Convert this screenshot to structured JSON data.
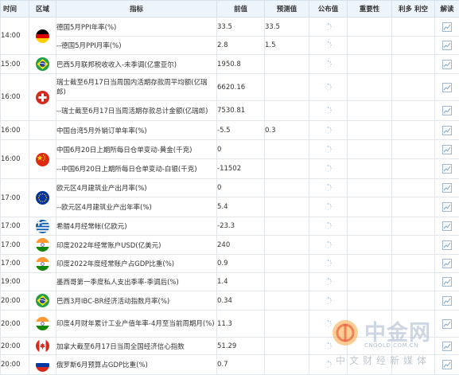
{
  "colors": {
    "header_bg": "#eef4fb",
    "grid": "#e3e6ea",
    "spinner": "#8fb3d9",
    "chart_icon": "#7fa3c9"
  },
  "header": {
    "time": "时间",
    "region": "区域",
    "indicator": "指标",
    "previous": "前值",
    "forecast": "预测值",
    "published": "公布值",
    "importance": "重要性",
    "impact": "利多 利空",
    "interpret": "解读"
  },
  "rows": [
    {
      "time": "14:00",
      "flag": "germany-flag",
      "indicator": "德国5月PPI年率(%)",
      "previous": "33.5",
      "forecast": "33.5",
      "published_icon": "loading-icon",
      "chart_icon": "chart-icon"
    },
    {
      "time": "",
      "flag": "",
      "indicator": "--德国5月PPI月率(%)",
      "previous": "2.8",
      "forecast": "1.5",
      "published_icon": "loading-icon",
      "chart_icon": "chart-icon"
    },
    {
      "time": "15:00",
      "flag": "brazil-flag",
      "indicator": "巴西5月联邦税收收入-未季调(亿雷亚尔)",
      "previous": "1950.8",
      "forecast": "",
      "published_icon": "loading-icon",
      "chart_icon": "chart-icon"
    },
    {
      "time": "16:00",
      "flag": "switzerland-flag",
      "indicator": "瑞士截至6月17日当周国内活期存款周平均额(亿瑞郎)",
      "previous": "6620.16",
      "forecast": "",
      "published_icon": "loading-icon",
      "chart_icon": "chart-icon"
    },
    {
      "time": "",
      "flag": "",
      "indicator": "--瑞士截至6月17日当周活期存款总计金额(亿瑞郎)",
      "previous": "7530.81",
      "forecast": "",
      "published_icon": "loading-icon",
      "chart_icon": "chart-icon"
    },
    {
      "time": "16:00",
      "flag": "",
      "indicator": "中国台湾5月外销订单年率(%)",
      "previous": "-5.5",
      "forecast": "0.3",
      "published_icon": "loading-icon",
      "chart_icon": "chart-icon"
    },
    {
      "time": "16:00",
      "flag": "china-flag",
      "indicator": "中国6月20日上期所每日仓单变动-黄金(千克)",
      "previous": "0",
      "forecast": "",
      "published_icon": "loading-icon",
      "chart_icon": "chart-icon"
    },
    {
      "time": "",
      "flag": "",
      "indicator": "--中国6月20日上期所每日仓单变动-白银(千克)",
      "previous": "-11502",
      "forecast": "",
      "published_icon": "loading-icon",
      "chart_icon": "chart-icon"
    },
    {
      "time": "17:00",
      "flag": "eu-flag",
      "indicator": "欧元区4月建筑业产出月率(%)",
      "previous": "0",
      "forecast": "",
      "published_icon": "loading-icon",
      "chart_icon": "chart-icon"
    },
    {
      "time": "",
      "flag": "",
      "indicator": "--欧元区4月建筑业产出年率(%)",
      "previous": "5.4",
      "forecast": "",
      "published_icon": "loading-icon",
      "chart_icon": "chart-icon"
    },
    {
      "time": "17:00",
      "flag": "greece-flag",
      "indicator": "希腊4月经常帐(亿欧元)",
      "previous": "-23.3",
      "forecast": "",
      "published_icon": "loading-icon",
      "chart_icon": "chart-icon"
    },
    {
      "time": "17:00",
      "flag": "india-flag",
      "indicator": "印度2022年经常账户USD(亿美元)",
      "previous": "240",
      "forecast": "",
      "published_icon": "loading-icon",
      "chart_icon": "chart-icon"
    },
    {
      "time": "17:00",
      "flag": "india-flag",
      "indicator": "印度2022年度经常账户占GDP比重(%)",
      "previous": "0.9",
      "forecast": "",
      "published_icon": "loading-icon",
      "chart_icon": "chart-icon"
    },
    {
      "time": "19:00",
      "flag": "",
      "indicator": "墨西哥第一季度私人支出季率-季调后(%)",
      "previous": "1.4",
      "forecast": "",
      "published_icon": "loading-icon",
      "chart_icon": "chart-icon"
    },
    {
      "time": "20:00",
      "flag": "brazil-flag",
      "indicator": "巴西3月IBC-BR经济活动指数月率(%)",
      "previous": "0.34",
      "forecast": "",
      "published_icon": "loading-icon",
      "chart_icon": "chart-icon"
    },
    {
      "time": "20:00",
      "flag": "india-flag",
      "indicator": "印度4月财年累计工业产值年率-4月至当前周期月(%)",
      "previous": "11.3",
      "forecast": "",
      "published_icon": "loading-icon",
      "chart_icon": "chart-icon"
    },
    {
      "time": "20:00",
      "flag": "canada-flag",
      "indicator": "加拿大截至6月17日当周全国经济信心指数",
      "previous": "51.29",
      "forecast": "",
      "published_icon": "loading-icon",
      "chart_icon": "chart-icon"
    },
    {
      "time": "20:00",
      "flag": "russia-flag",
      "indicator": "俄罗斯6月预算占GDP比重(%)",
      "previous": "0.7",
      "forecast": "",
      "published_icon": "loading-icon",
      "chart_icon": "chart-icon"
    }
  ],
  "watermark": {
    "name": "中金网",
    "url": "CNGOLD.COM.CN",
    "slogan": "中文财经新媒体"
  }
}
